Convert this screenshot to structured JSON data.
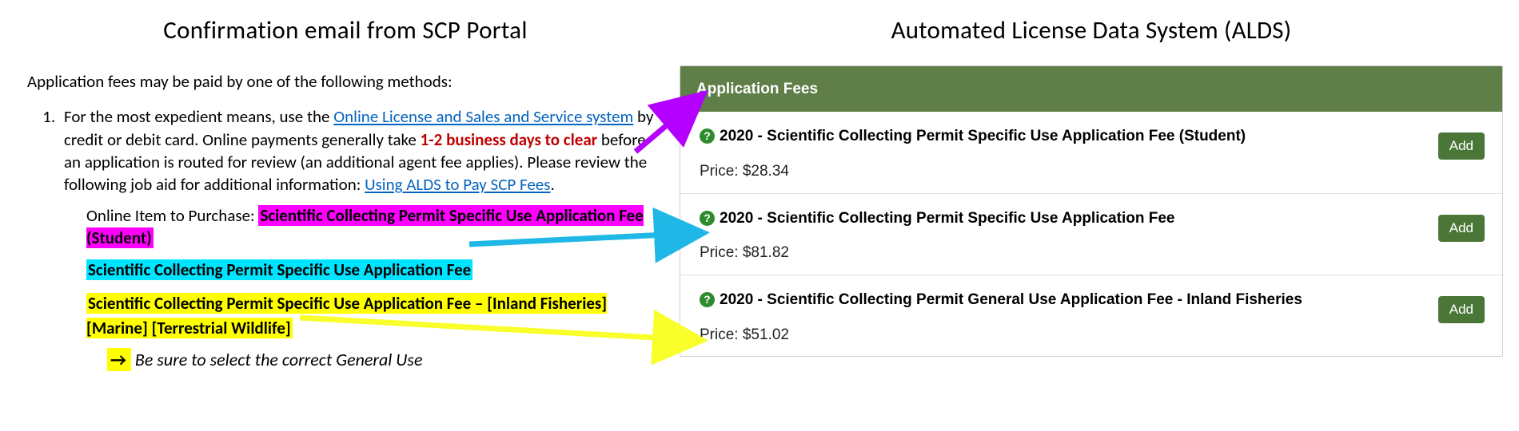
{
  "left": {
    "title": "Confirmation email from SCP Portal",
    "intro": "Application fees may be paid by one of the following methods:",
    "item_lead": "For the most expedient means, use the ",
    "link_olsss": "Online License and Sales and Service system",
    "item_after_link": " by credit or debit card. Online payments generally take ",
    "days_bold": "1-2 business days to clear",
    "item_tail1": " before an application is routed for review (an additional agent fee applies). Please review the following job aid for additional information:  ",
    "link_alds": "Using ALDS to Pay SCP Fees",
    "period": ".",
    "purchase_label": "Online Item to Purchase:  ",
    "hl_pink": "Scientific Collecting Permit Specific Use Application Fee (Student)",
    "hl_cyan": "Scientific Collecting Permit Specific Use Application Fee",
    "hl_yel": "Scientific Collecting Permit Specific Use Application Fee – [Inland Fisheries] [Marine] [Terrestrial Wildlife]",
    "note_arrow": "→",
    "note_text": " Be sure to select the correct General Use"
  },
  "right": {
    "title": "Automated License Data System (ALDS)",
    "panel_header": "Application Fees",
    "fees": [
      {
        "name": "2020 - Scientific Collecting Permit Specific Use Application Fee (Student)",
        "price": "Price: $28.34",
        "add": "Add"
      },
      {
        "name": "2020 - Scientific Collecting Permit Specific Use Application Fee",
        "price": "Price: $81.82",
        "add": "Add"
      },
      {
        "name": "2020 - Scientific Collecting Permit General Use Application Fee - Inland Fisheries",
        "price": "Price: $51.02",
        "add": "Add"
      }
    ]
  }
}
